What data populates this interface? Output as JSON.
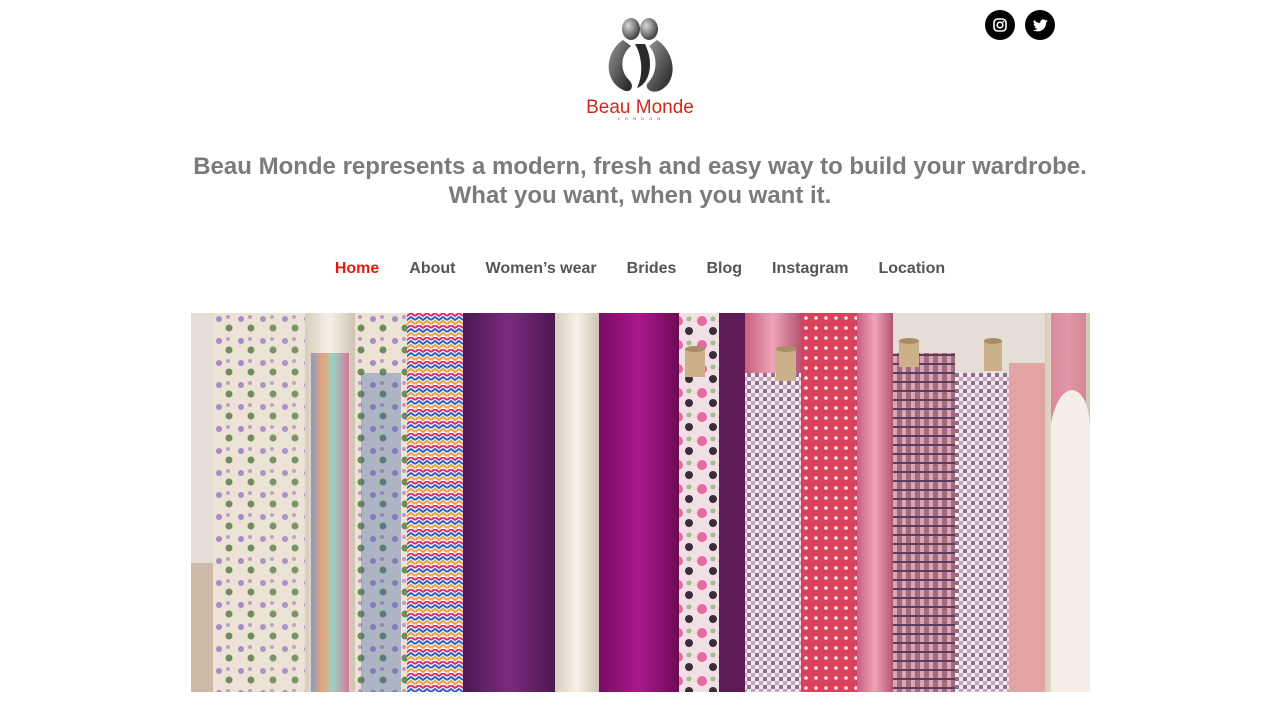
{
  "brand": {
    "logo_text": "Beau Monde",
    "logo_subtext": "L O N D O N",
    "accent_color": "#e8180e"
  },
  "social": [
    {
      "label": "Instagram",
      "icon": "instagram-icon"
    },
    {
      "label": "Twitter",
      "icon": "twitter-icon"
    }
  ],
  "tagline": {
    "line1": "Beau Monde represents a modern, fresh and easy way to build your wardrobe.",
    "line2": "What you want, when you want it."
  },
  "nav": {
    "active": "Home",
    "items": [
      {
        "label": "Home"
      },
      {
        "label": "About"
      },
      {
        "label": "Women’s wear"
      },
      {
        "label": "Brides"
      },
      {
        "label": "Blog"
      },
      {
        "label": "Instagram"
      },
      {
        "label": "Location"
      }
    ]
  },
  "hero": {
    "subject": "rolls of colourful fabric bolts"
  }
}
